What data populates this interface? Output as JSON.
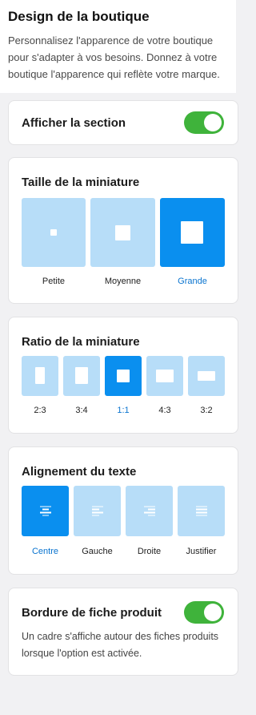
{
  "header": {
    "title": "Design de la boutique",
    "description": "Personnalisez l'apparence de votre boutique pour s'adapter à vos besoins. Donnez à votre boutique l'apparence qui reflète votre marque."
  },
  "show_section": {
    "label": "Afficher la section",
    "enabled": true
  },
  "thumbnail_size": {
    "title": "Taille de la miniature",
    "options": [
      {
        "label": "Petite",
        "selected": false
      },
      {
        "label": "Moyenne",
        "selected": false
      },
      {
        "label": "Grande",
        "selected": true
      }
    ]
  },
  "thumbnail_ratio": {
    "title": "Ratio de la miniature",
    "options": [
      {
        "label": "2:3",
        "selected": false
      },
      {
        "label": "3:4",
        "selected": false
      },
      {
        "label": "1:1",
        "selected": true
      },
      {
        "label": "4:3",
        "selected": false
      },
      {
        "label": "3:2",
        "selected": false
      }
    ]
  },
  "text_alignment": {
    "title": "Alignement du texte",
    "options": [
      {
        "label": "Centre",
        "icon": "align-center-icon",
        "selected": true
      },
      {
        "label": "Gauche",
        "icon": "align-left-icon",
        "selected": false
      },
      {
        "label": "Droite",
        "icon": "align-right-icon",
        "selected": false
      },
      {
        "label": "Justifier",
        "icon": "align-justify-icon",
        "selected": false
      }
    ]
  },
  "product_border": {
    "label": "Bordure de fiche produit",
    "enabled": true,
    "description": "Un cadre s'affiche autour des fiches produits lorsque l'option est activée."
  },
  "colors": {
    "accent": "#0a8fef",
    "option_bg": "#b7ddf8",
    "toggle_on": "#3fb33b",
    "selected_label": "#0a74cf"
  }
}
